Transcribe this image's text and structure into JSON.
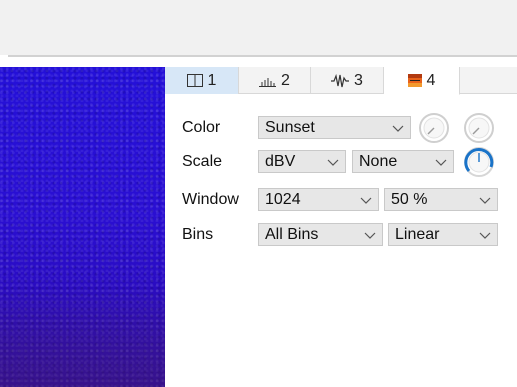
{
  "tabs": [
    {
      "number": "1",
      "icon": "panel-split-icon"
    },
    {
      "number": "2",
      "icon": "bar-spectrum-icon"
    },
    {
      "number": "3",
      "icon": "waveform-icon"
    },
    {
      "number": "4",
      "icon": "spectrogram-icon"
    }
  ],
  "active_tab": "4",
  "settings": {
    "color_label": "Color",
    "color_value": "Sunset",
    "scale_label": "Scale",
    "scale_value": "dBV",
    "scale_extra_value": "None",
    "window_label": "Window",
    "window_value": "1024",
    "overlap_value": "50 %",
    "bins_label": "Bins",
    "bins_value": "All Bins",
    "bins_mode_value": "Linear"
  },
  "colors": {
    "spectrogram": "#2a10d0",
    "active_knob": "#1a73c8",
    "tab_highlight": "#d7e7f7"
  }
}
